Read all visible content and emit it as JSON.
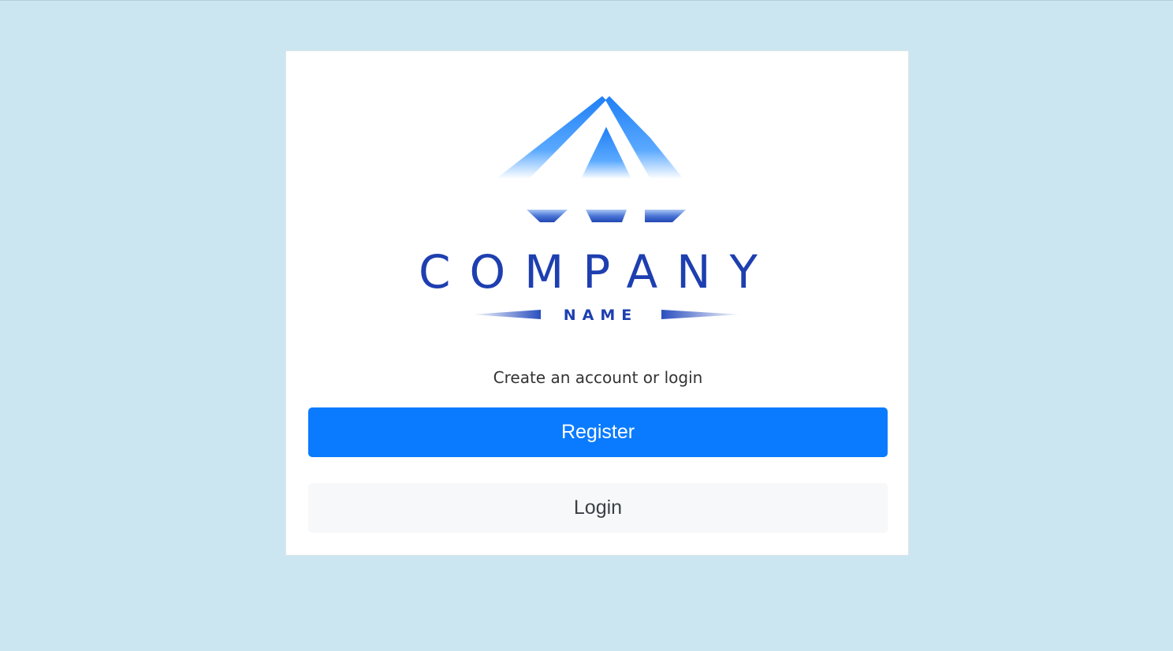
{
  "logo": {
    "company_text": "COMPANY",
    "name_text": "NAME",
    "icon": "diamond-icon",
    "colors": {
      "text": "#1e3fb0",
      "gradient_top": "#2f8cff",
      "gradient_bottom": "#ffffff",
      "bar_dark": "#2a4fbf"
    }
  },
  "auth": {
    "prompt": "Create an account or login",
    "register_label": "Register",
    "login_label": "Login"
  },
  "colors": {
    "background": "#cbe6f1",
    "primary": "#0a7bff",
    "secondary": "#f7f8fa"
  }
}
